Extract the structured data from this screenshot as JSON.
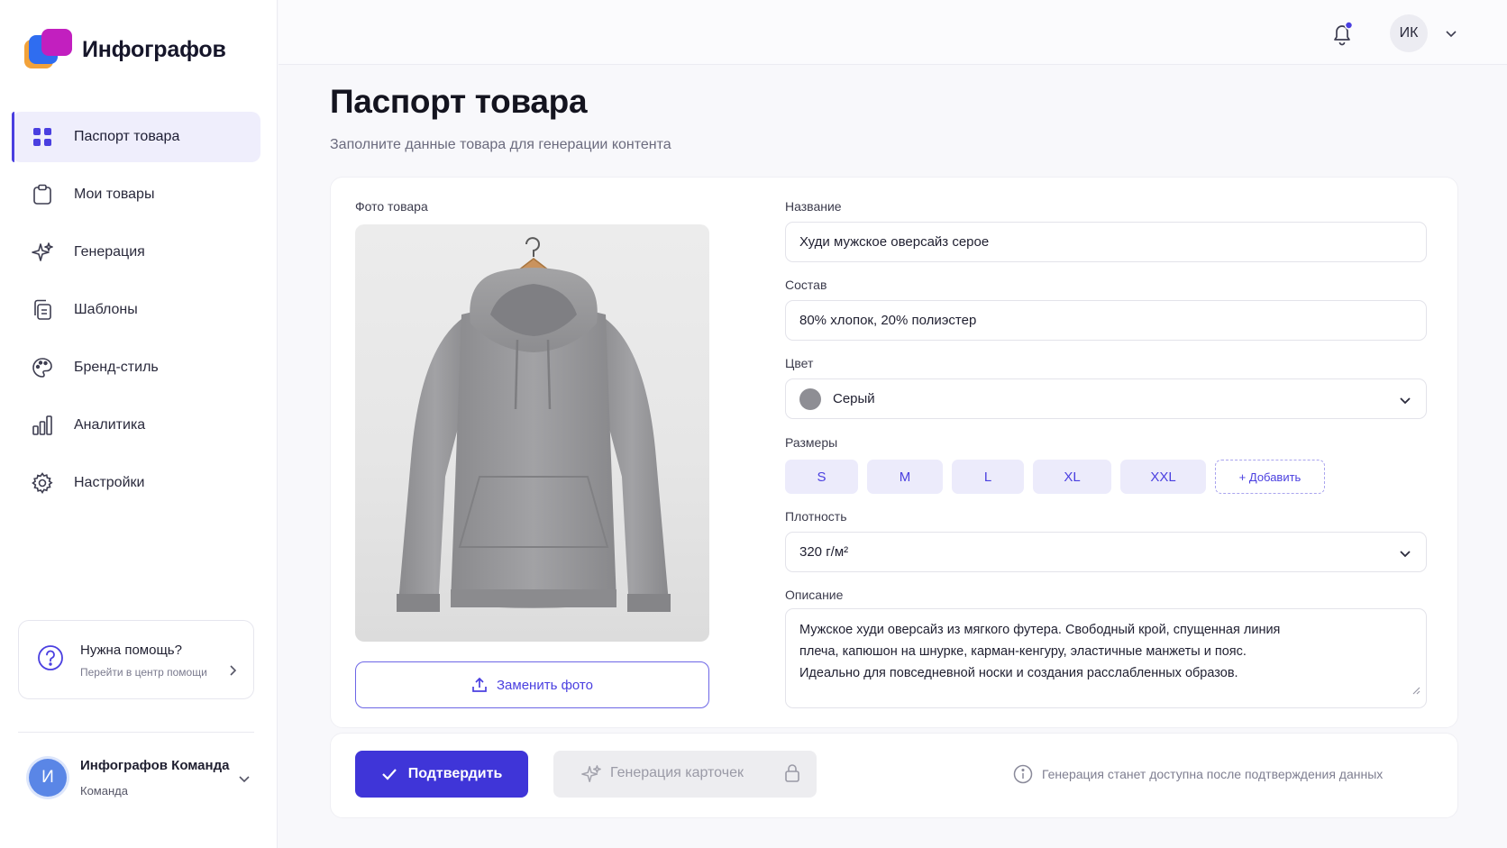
{
  "app": {
    "name": "Инфографов"
  },
  "sidebar": {
    "items": [
      {
        "label": "Паспорт товара",
        "icon": "grid-icon",
        "active": true
      },
      {
        "label": "Мои товары",
        "icon": "clipboard-icon"
      },
      {
        "label": "Генерация",
        "icon": "sparkle-icon"
      },
      {
        "label": "Шаблоны",
        "icon": "copy-icon"
      },
      {
        "label": "Бренд-стиль",
        "icon": "palette-icon"
      },
      {
        "label": "Аналитика",
        "icon": "bar-chart-icon"
      },
      {
        "label": "Настройки",
        "icon": "gear-icon"
      }
    ],
    "help": {
      "title": "Нужна помощь?",
      "link": "Перейти в центр помощи"
    },
    "team": {
      "avatar": "И",
      "name": "Инфографов Команда",
      "role": "Команда"
    }
  },
  "topbar": {
    "user_initials": "ИК",
    "has_notification": true
  },
  "main": {
    "title": "Паспорт товара",
    "subtitle": "Заполните данные товара для генерации контента",
    "photo": {
      "label": "Фото товара",
      "replace_label": "Заменить фото"
    },
    "fields": {
      "name": {
        "label": "Название",
        "value": "Худи мужское оверсайз серое"
      },
      "composition": {
        "label": "Состав",
        "value": "80% хлопок, 20% полиэстер"
      },
      "color": {
        "label": "Цвет",
        "value": "Серый",
        "swatch": "#8e8e94"
      },
      "sizes": {
        "label": "Размеры",
        "items": [
          "S",
          "M",
          "L",
          "XL",
          "XXL"
        ],
        "add_label": "+ Добавить"
      },
      "density": {
        "label": "Плотность",
        "value": "320 г/м²"
      },
      "description": {
        "label": "Описание",
        "value": "Мужское худи оверсайз из мягкого футера. Свободный крой, спущенная линия плеча, капюшон на шнурке, карман-кенгуру, эластичные манжеты и пояс. Идеально для повседневной носки и создания расслабленных образов."
      }
    },
    "actions": {
      "confirm_label": "Подтвердить",
      "generate_label": "Генерация карточек",
      "note": "Генерация станет доступна после подтверждения данных"
    }
  },
  "colors": {
    "accent": "#3f35d8",
    "accent_light": "#ecebfb",
    "brand_orange": "#f2a23a",
    "brand_blue": "#2f6df0",
    "brand_magenta": "#c21fbf"
  }
}
